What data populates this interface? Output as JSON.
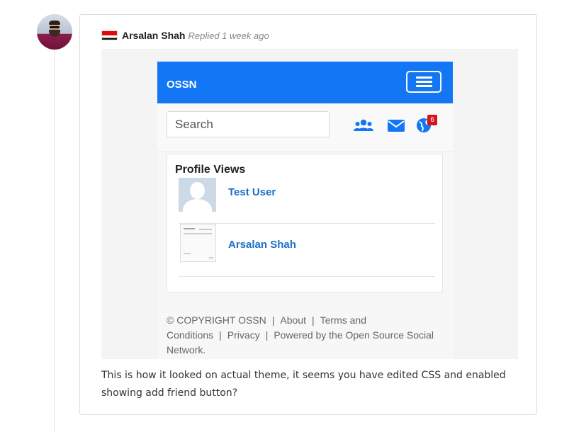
{
  "comment": {
    "author": "Arsalan Shah",
    "replied": "Replied 1 week ago",
    "text": "This is how it looked on actual theme, it seems you have edited CSS and enabled showing add friend button?"
  },
  "screenshot": {
    "brand": "OSSN",
    "search_placeholder": "Search",
    "notification_count": "6",
    "widget_title": "Profile Views",
    "profile_views": [
      {
        "name": "Test User"
      },
      {
        "name": "Arsalan Shah"
      }
    ],
    "footer": {
      "copyright": "© COPYRIGHT OSSN",
      "about": "About",
      "terms": "Terms and Conditions",
      "privacy": "Privacy",
      "powered": "Powered by the Open Source Social Network."
    },
    "colors": {
      "topbar": "#1276f5",
      "link": "#1b6fc7",
      "badge": "#d6141b"
    }
  }
}
